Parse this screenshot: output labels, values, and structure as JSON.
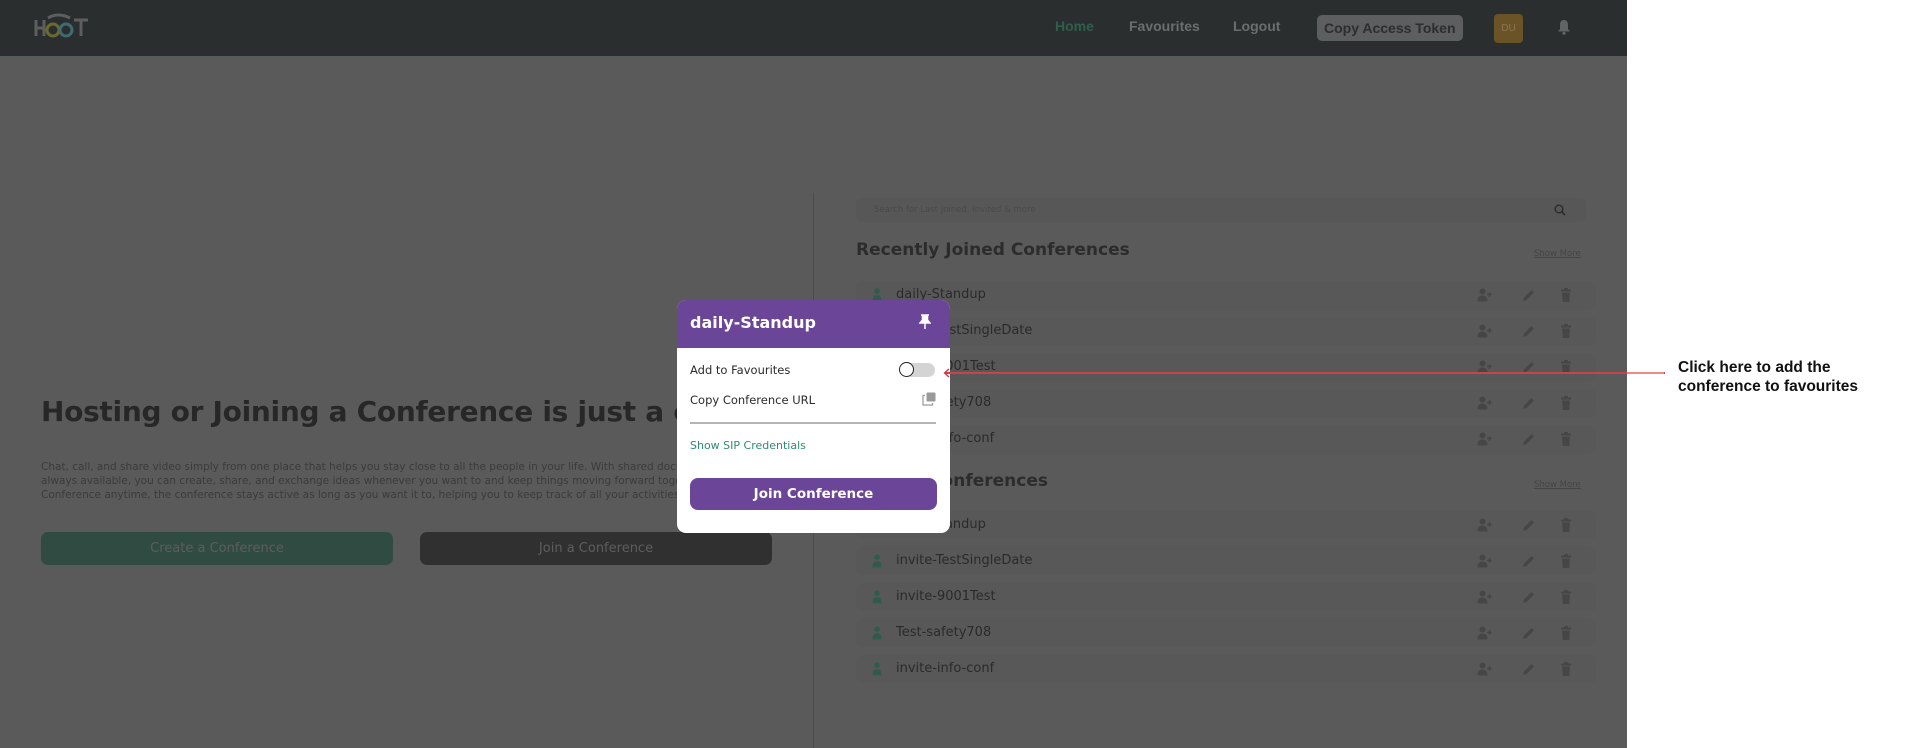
{
  "navbar": {
    "logo_text": "HOOT",
    "links": [
      {
        "label": "Home",
        "active": true
      },
      {
        "label": "Favourites",
        "active": false
      },
      {
        "label": "Logout",
        "active": false
      }
    ],
    "copy_token_label": "Copy Access Token",
    "avatar_initials": "DU",
    "bell_icon": "bell-icon"
  },
  "hero": {
    "title": "Hosting or Joining a Conference is just a click a",
    "description_lines": [
      "Chat, call, and share video simply from one place that helps you stay close to all the people in your life. With shared docume",
      "always available, you can create, share, and exchange ideas whenever you want to and keep things moving forward togethe",
      "Conference anytime, the conference stays active as long as you want it to, helping you to keep track of all your activities."
    ],
    "create_button": "Create a Conference",
    "join_button": "Join a Conference"
  },
  "search": {
    "placeholder": "Search for Last Joined, Invited & more",
    "icon": "search-icon"
  },
  "sections": [
    {
      "title": "Recently Joined Conferences",
      "show_more": "Show More",
      "rows": [
        {
          "name": "daily-Standup"
        },
        {
          "name": "invite-TestSingleDate"
        },
        {
          "name": "invite-9001Test"
        },
        {
          "name": "Test-safety708"
        },
        {
          "name": "invite-info-conf"
        }
      ]
    },
    {
      "title": "Invited Conferences",
      "show_more": "Show More",
      "rows": [
        {
          "name": "daily-Standup"
        },
        {
          "name": "invite-TestSingleDate"
        },
        {
          "name": "invite-9001Test"
        },
        {
          "name": "Test-safety708"
        },
        {
          "name": "invite-info-conf"
        }
      ]
    }
  ],
  "modal": {
    "title": "daily-Standup",
    "add_favourites_label": "Add to Favourites",
    "favourite_on": false,
    "copy_url_label": "Copy Conference URL",
    "sip_link": "Show SIP Credentials",
    "join_button": "Join Conference"
  },
  "annotation": {
    "text": "Click here to add the conference to favourites"
  },
  "colors": {
    "brand_purple": "#6a4598",
    "accent_green": "#2e8a72",
    "annotation_red": "#c7454a"
  }
}
